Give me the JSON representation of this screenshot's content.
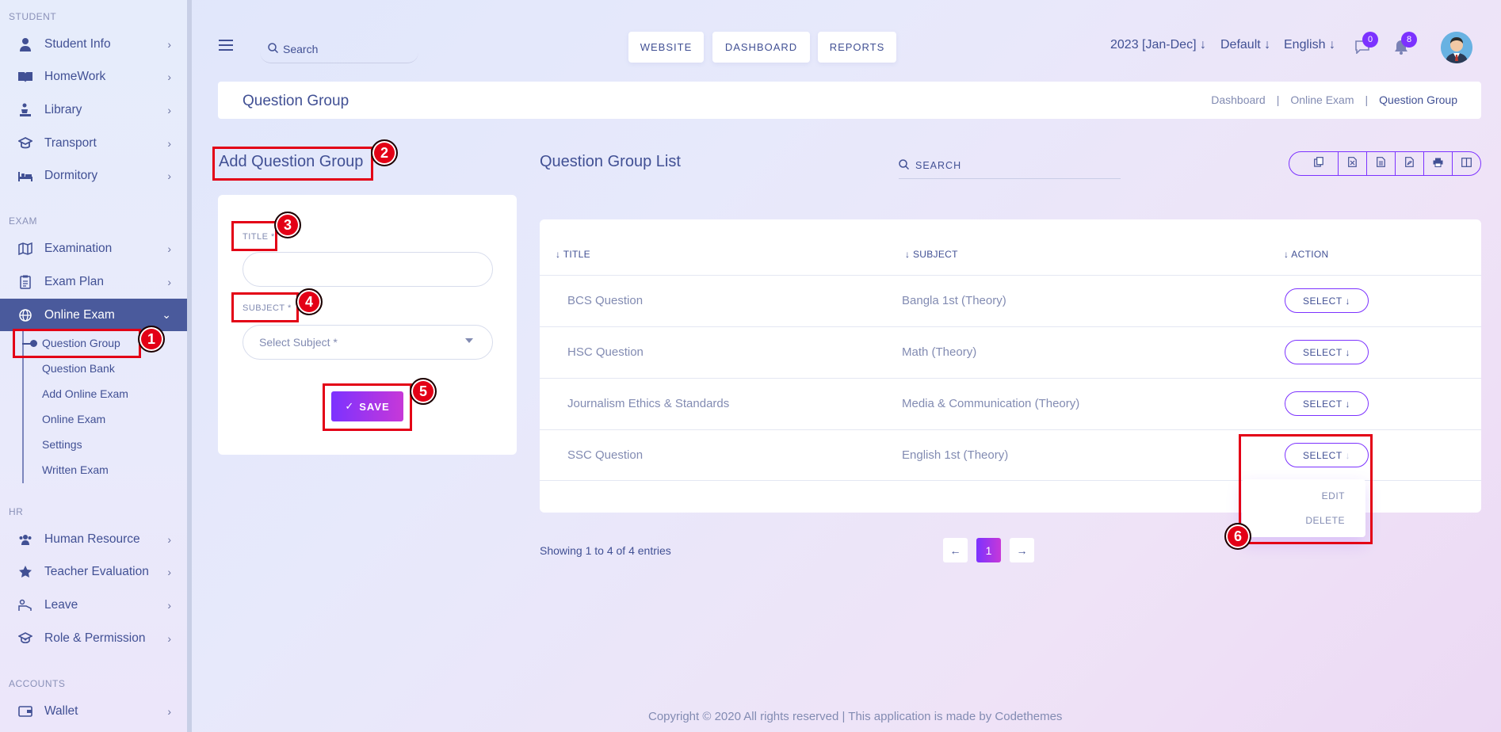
{
  "sidebar": {
    "sections": {
      "student": "STUDENT",
      "exam": "EXAM",
      "hr": "HR",
      "accounts": "ACCOUNTS"
    },
    "items": {
      "student_info": "Student Info",
      "homework": "HomeWork",
      "library": "Library",
      "transport": "Transport",
      "dormitory": "Dormitory",
      "examination": "Examination",
      "exam_plan": "Exam Plan",
      "online_exam": "Online Exam",
      "human_resource": "Human Resource",
      "teacher_evaluation": "Teacher Evaluation",
      "leave": "Leave",
      "role_permission": "Role & Permission",
      "wallet": "Wallet"
    },
    "submenu": [
      "Question Group",
      "Question Bank",
      "Add Online Exam",
      "Online Exam",
      "Settings",
      "Written Exam"
    ]
  },
  "topbar": {
    "search_label": "Search",
    "buttons": [
      "WEBSITE",
      "DASHBOARD",
      "REPORTS"
    ],
    "year": "2023 [Jan-Dec]",
    "theme": "Default",
    "language": "English",
    "messages_count": "0",
    "notifications_count": "8"
  },
  "header": {
    "title": "Question Group",
    "breadcrumb": [
      "Dashboard",
      "Online Exam",
      "Question Group"
    ],
    "sep": "|"
  },
  "form": {
    "title": "Add Question Group",
    "title_label": "TITLE *",
    "title_value": "",
    "subject_label": "SUBJECT *",
    "subject_placeholder": "Select Subject *",
    "save_label": "SAVE"
  },
  "list": {
    "title": "Question Group List",
    "search_label": "SEARCH",
    "columns": [
      "TITLE",
      "SUBJECT",
      "ACTION"
    ],
    "rows": [
      {
        "title": "BCS Question",
        "subject": "Bangla 1st (Theory)",
        "action": "SELECT"
      },
      {
        "title": "HSC Question",
        "subject": "Math (Theory)",
        "action": "SELECT"
      },
      {
        "title": "Journalism Ethics & Standards",
        "subject": "Media & Communication (Theory)",
        "action": "SELECT"
      },
      {
        "title": "SSC Question",
        "subject": "English 1st (Theory)",
        "action": "SELECT"
      }
    ],
    "dropdown": [
      "EDIT",
      "DELETE"
    ],
    "showing": "Showing 1 to 4 of 4 entries",
    "page": "1"
  },
  "annotations": [
    "1",
    "2",
    "3",
    "4",
    "5",
    "6"
  ],
  "footer": "Copyright © 2020 All rights reserved | This application is made by Codethemes",
  "colors": {
    "accent": "#7c32ff",
    "primary_text": "#415094",
    "muted_text": "#828bb2",
    "annotation": "#e30016",
    "active_menu": "#4a5a9c"
  }
}
